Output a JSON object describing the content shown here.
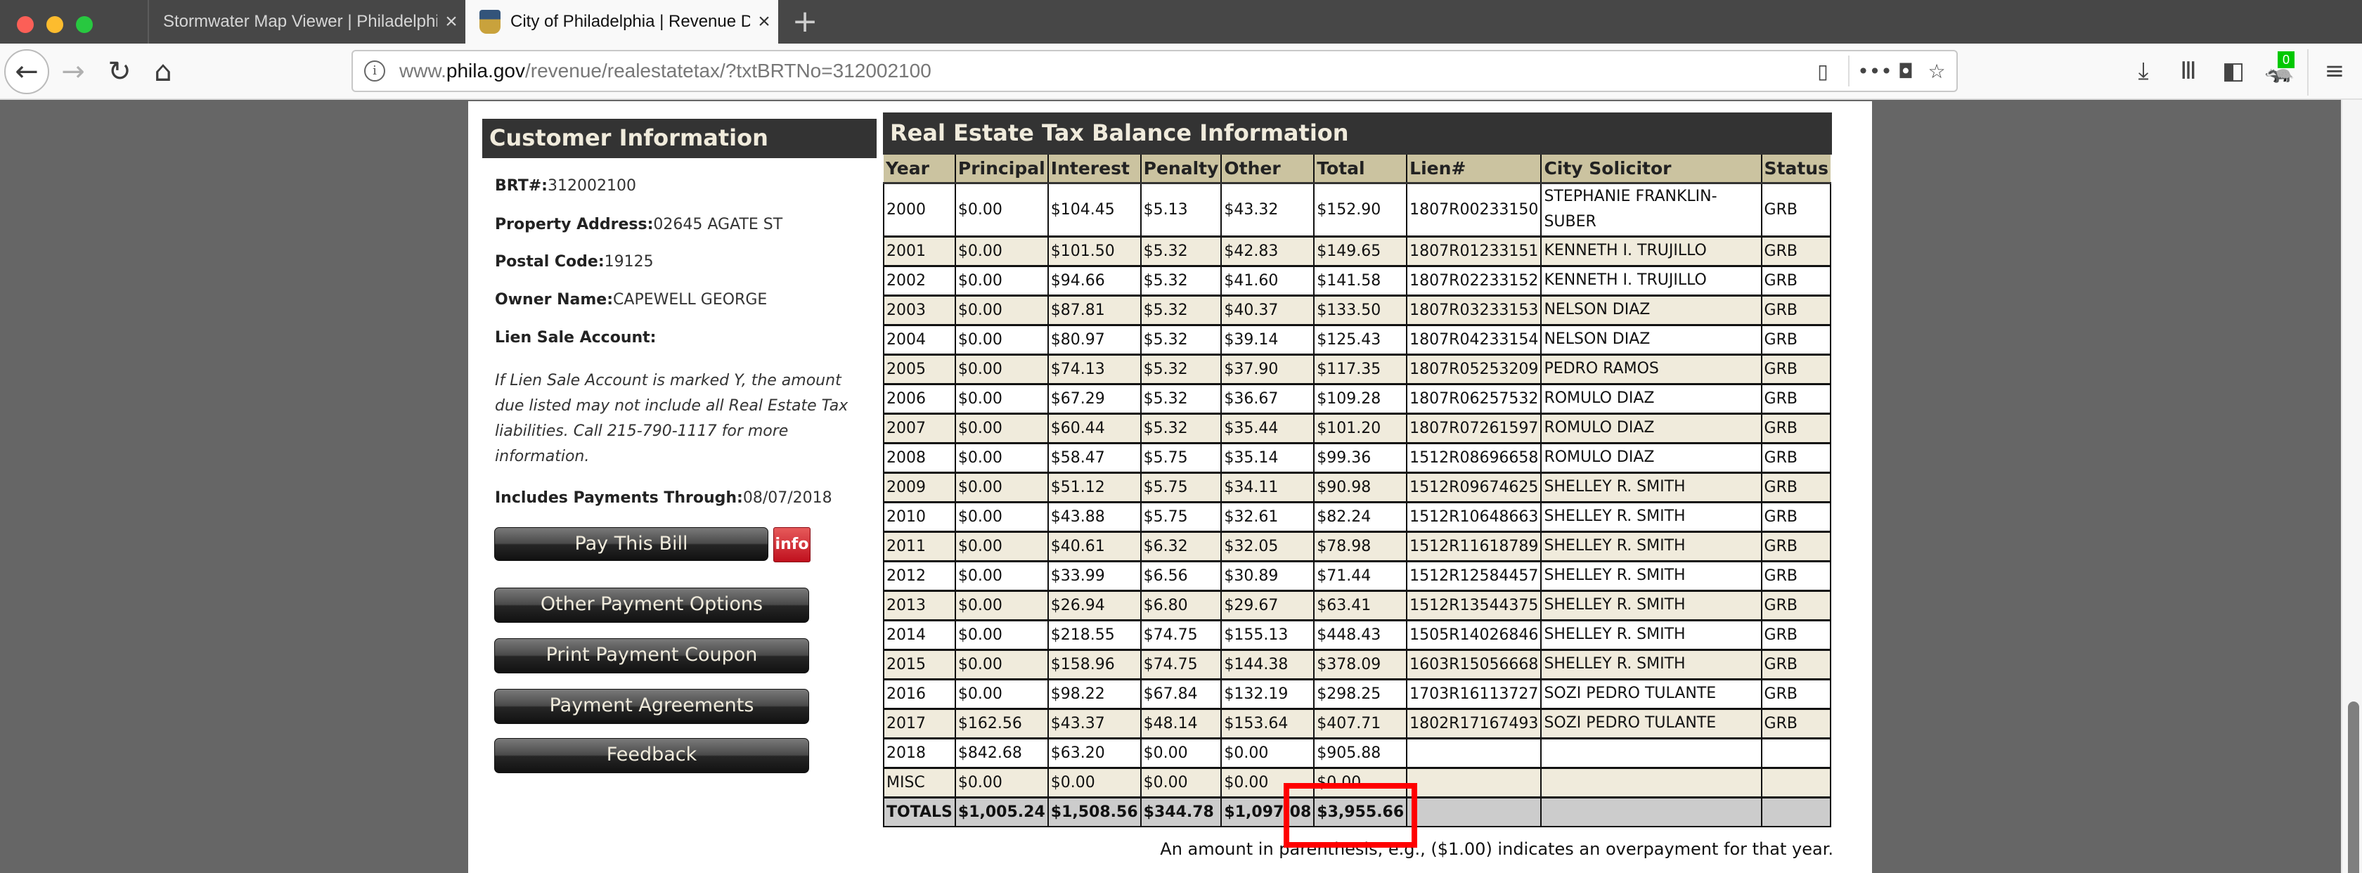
{
  "browser": {
    "tabs": [
      {
        "title": "Stormwater Map Viewer | Philadelphia",
        "active": false,
        "close_icon": "close-icon"
      },
      {
        "title": "City of Philadelphia | Revenue Department",
        "active": true,
        "close_icon": "close-icon",
        "favicon": "city-seal-icon"
      }
    ],
    "new_tab_symbol": "+",
    "url_domain_prefix": "www.",
    "url_domain": "phila.gov",
    "url_path": "/revenue/realestatetax/?txtBRTNo=312002100",
    "extension_badge_count": "0"
  },
  "customer": {
    "header": "Customer Information",
    "fields": [
      {
        "label": "BRT#:",
        "value": "312002100"
      },
      {
        "label": "Property Address:",
        "value": "02645 AGATE ST"
      },
      {
        "label": "Postal Code:",
        "value": "19125"
      },
      {
        "label": "Owner Name:",
        "value": "CAPEWELL GEORGE"
      },
      {
        "label": "Lien Sale Account:",
        "value": ""
      }
    ],
    "lien_note": "If Lien Sale Account is marked Y, the amount due listed may not include all Real Estate Tax liabilities. Call 215-790-1117 for more information.",
    "payments_through_label": "Includes Payments Through:",
    "payments_through_value": "08/07/2018"
  },
  "buttons": {
    "pay_bill": "Pay This Bill",
    "info": "info",
    "other_options": "Other Payment Options",
    "print_coupon": "Print Payment Coupon",
    "agreements": "Payment Agreements",
    "feedback": "Feedback"
  },
  "balance": {
    "title": "Real Estate Tax Balance Information",
    "columns": [
      "Year",
      "Principal",
      "Interest",
      "Penalty",
      "Other",
      "Total",
      "Lien#",
      "City Solicitor",
      "Status"
    ],
    "rows": [
      [
        "2000",
        "$0.00",
        "$104.45",
        "$5.13",
        "$43.32",
        "$152.90",
        "1807R00233150",
        "STEPHANIE FRANKLIN-SUBER",
        "GRB"
      ],
      [
        "2001",
        "$0.00",
        "$101.50",
        "$5.32",
        "$42.83",
        "$149.65",
        "1807R01233151",
        "KENNETH I. TRUJILLO",
        "GRB"
      ],
      [
        "2002",
        "$0.00",
        "$94.66",
        "$5.32",
        "$41.60",
        "$141.58",
        "1807R02233152",
        "KENNETH I. TRUJILLO",
        "GRB"
      ],
      [
        "2003",
        "$0.00",
        "$87.81",
        "$5.32",
        "$40.37",
        "$133.50",
        "1807R03233153",
        "NELSON DIAZ",
        "GRB"
      ],
      [
        "2004",
        "$0.00",
        "$80.97",
        "$5.32",
        "$39.14",
        "$125.43",
        "1807R04233154",
        "NELSON DIAZ",
        "GRB"
      ],
      [
        "2005",
        "$0.00",
        "$74.13",
        "$5.32",
        "$37.90",
        "$117.35",
        "1807R05253209",
        "PEDRO RAMOS",
        "GRB"
      ],
      [
        "2006",
        "$0.00",
        "$67.29",
        "$5.32",
        "$36.67",
        "$109.28",
        "1807R06257532",
        "ROMULO DIAZ",
        "GRB"
      ],
      [
        "2007",
        "$0.00",
        "$60.44",
        "$5.32",
        "$35.44",
        "$101.20",
        "1807R07261597",
        "ROMULO DIAZ",
        "GRB"
      ],
      [
        "2008",
        "$0.00",
        "$58.47",
        "$5.75",
        "$35.14",
        "$99.36",
        "1512R08696658",
        "ROMULO DIAZ",
        "GRB"
      ],
      [
        "2009",
        "$0.00",
        "$51.12",
        "$5.75",
        "$34.11",
        "$90.98",
        "1512R09674625",
        "SHELLEY R. SMITH",
        "GRB"
      ],
      [
        "2010",
        "$0.00",
        "$43.88",
        "$5.75",
        "$32.61",
        "$82.24",
        "1512R10648663",
        "SHELLEY R. SMITH",
        "GRB"
      ],
      [
        "2011",
        "$0.00",
        "$40.61",
        "$6.32",
        "$32.05",
        "$78.98",
        "1512R11618789",
        "SHELLEY R. SMITH",
        "GRB"
      ],
      [
        "2012",
        "$0.00",
        "$33.99",
        "$6.56",
        "$30.89",
        "$71.44",
        "1512R12584457",
        "SHELLEY R. SMITH",
        "GRB"
      ],
      [
        "2013",
        "$0.00",
        "$26.94",
        "$6.80",
        "$29.67",
        "$63.41",
        "1512R13544375",
        "SHELLEY R. SMITH",
        "GRB"
      ],
      [
        "2014",
        "$0.00",
        "$218.55",
        "$74.75",
        "$155.13",
        "$448.43",
        "1505R14026846",
        "SHELLEY R. SMITH",
        "GRB"
      ],
      [
        "2015",
        "$0.00",
        "$158.96",
        "$74.75",
        "$144.38",
        "$378.09",
        "1603R15056668",
        "SHELLEY R. SMITH",
        "GRB"
      ],
      [
        "2016",
        "$0.00",
        "$98.22",
        "$67.84",
        "$132.19",
        "$298.25",
        "1703R16113727",
        "SOZI PEDRO TULANTE",
        "GRB"
      ],
      [
        "2017",
        "$162.56",
        "$43.37",
        "$48.14",
        "$153.64",
        "$407.71",
        "1802R17167493",
        "SOZI PEDRO TULANTE",
        "GRB"
      ],
      [
        "2018",
        "$842.68",
        "$63.20",
        "$0.00",
        "$0.00",
        "$905.88",
        "",
        "",
        ""
      ],
      [
        "MISC",
        "$0.00",
        "$0.00",
        "$0.00",
        "$0.00",
        "$0.00",
        "",
        "",
        ""
      ]
    ],
    "totals": [
      "TOTALS",
      "$1,005.24",
      "$1,508.56",
      "$344.78",
      "$1,097.08",
      "$3,955.66",
      "",
      "",
      ""
    ],
    "footnote": "An amount in parenthesis, e.g., ($1.00) indicates an overpayment for that year."
  },
  "annotation": {
    "highlight_color": "#ff0000",
    "highlighted_value": "$3,955.66"
  },
  "colors": {
    "header_dark": "#333333",
    "header_text": "#f0ebdc",
    "column_header_bg": "#cbc3a0",
    "row_beige": "#f0ebdc",
    "totals_bg": "#cccccc",
    "page_bg": "#666666"
  }
}
